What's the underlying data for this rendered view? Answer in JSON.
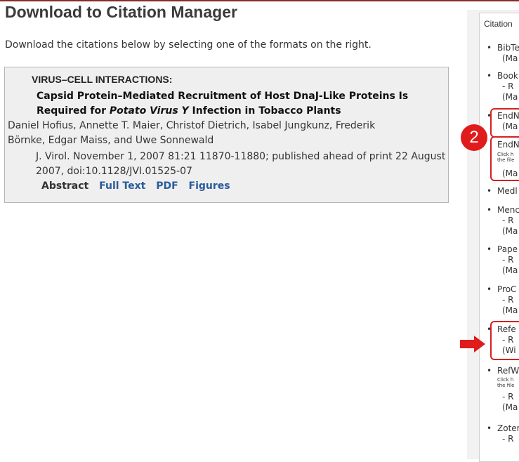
{
  "page": {
    "title": "Download to Citation Manager",
    "intro": "Download the citations below by selecting one of the formats on the right."
  },
  "citation": {
    "section": "VIRUS–CELL INTERACTIONS:",
    "title_part1": "Capsid Protein–Mediated Recruitment of Host DnaJ-Like Proteins Is Required for ",
    "title_italic": "Potato Virus Y",
    "title_part2": " Infection in Tobacco Plants",
    "authors": "Daniel Hofius, Annette T. Maier, Christof Dietrich, Isabel Jungkunz, Frederik Börnke, Edgar Maiss, and Uwe Sonnewald",
    "journal": "J. Virol. November 1, 2007 81:21 11870-11880; published ahead of print 22 August 2007, doi:10.1128/JVI.01525-07",
    "links": {
      "abstract": "Abstract",
      "full_text": "Full Text",
      "pdf": "PDF",
      "figures": "Figures"
    }
  },
  "sidebar": {
    "heading": "Citation",
    "items": [
      {
        "bullet": "•",
        "name": "BibTe",
        "sub": "(Ma"
      },
      {
        "bullet": "•",
        "name": "Book",
        "sub1": "- R",
        "sub": "(Ma"
      },
      {
        "bullet": "•",
        "name": "EndN",
        "sub": "(Ma"
      },
      {
        "name": "EndN",
        "small1": "Click h",
        "small2": "the file",
        "sub": "(Ma"
      },
      {
        "bullet": "•",
        "name": "Medl"
      },
      {
        "bullet": "•",
        "name": "Menc",
        "sub1": "- R",
        "sub": "(Ma"
      },
      {
        "bullet": "•",
        "name": "Pape",
        "sub1": "- R",
        "sub": "(Ma"
      },
      {
        "bullet": "•",
        "name": "ProC",
        "sub1": "- R",
        "sub": "(Ma"
      },
      {
        "bullet": "•",
        "name": "Refe",
        "sub1": "- R",
        "sub": "(Wi"
      },
      {
        "bullet": "•",
        "name": "RefW",
        "small1": "Click h",
        "small2": "the file",
        "sub1": "- R",
        "sub": "(Ma"
      },
      {
        "bullet": "•",
        "name": "Zoter",
        "sub1": "- R"
      }
    ]
  },
  "annotations": {
    "step_badge": "2",
    "highlight_color": "#d32222"
  }
}
